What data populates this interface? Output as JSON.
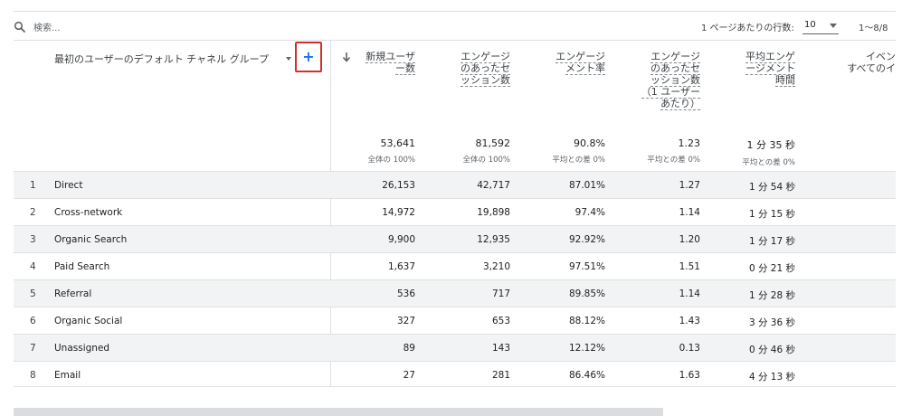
{
  "toolbar": {
    "search_placeholder": "検索...",
    "rows_per_page_label": "1 ページあたりの行数:",
    "rows_per_page_value": "10",
    "pager_text": "1〜8/8"
  },
  "table": {
    "dimension_header": "最初のユーザーのデフォルト チャネル グループ",
    "add_dimension_symbol": "+",
    "columns": [
      {
        "key": "new_users",
        "label_lines": [
          "新規ユーザ",
          "ー数"
        ],
        "total": "53,641",
        "total_sub": "全体の 100%"
      },
      {
        "key": "engaged_sessions",
        "label_lines": [
          "エンゲージ",
          "のあったセ",
          "ッション数"
        ],
        "total": "81,592",
        "total_sub": "全体の 100%"
      },
      {
        "key": "engagement_rate",
        "label_lines": [
          "エンゲージ",
          "メント率"
        ],
        "total": "90.8%",
        "total_sub": "平均との差 0%"
      },
      {
        "key": "engaged_sessions_per_user",
        "label_lines": [
          "エンゲージ",
          "のあったセ",
          "ッション数",
          "（1 ユーザー",
          "あたり）"
        ],
        "total": "1.23",
        "total_sub": "平均との差 0%"
      },
      {
        "key": "avg_engagement_time",
        "label_lines": [
          "平均エンゲ",
          "ージメント",
          "時間"
        ],
        "total": "1 分 35 秒",
        "total_sub": "平均との差 0%"
      },
      {
        "key": "event_count",
        "label_lines": [
          "イベン",
          "すべてのイ"
        ],
        "total": "",
        "total_sub": ""
      }
    ],
    "rows": [
      {
        "index": "1",
        "label": "Direct",
        "new_users": "26,153",
        "engaged_sessions": "42,717",
        "engagement_rate": "87.01%",
        "engaged_sessions_per_user": "1.27",
        "avg_engagement_time": "1 分 54 秒"
      },
      {
        "index": "2",
        "label": "Cross-network",
        "new_users": "14,972",
        "engaged_sessions": "19,898",
        "engagement_rate": "97.4%",
        "engaged_sessions_per_user": "1.14",
        "avg_engagement_time": "1 分 15 秒"
      },
      {
        "index": "3",
        "label": "Organic Search",
        "new_users": "9,900",
        "engaged_sessions": "12,935",
        "engagement_rate": "92.92%",
        "engaged_sessions_per_user": "1.20",
        "avg_engagement_time": "1 分 17 秒"
      },
      {
        "index": "4",
        "label": "Paid Search",
        "new_users": "1,637",
        "engaged_sessions": "3,210",
        "engagement_rate": "97.51%",
        "engaged_sessions_per_user": "1.51",
        "avg_engagement_time": "0 分 21 秒"
      },
      {
        "index": "5",
        "label": "Referral",
        "new_users": "536",
        "engaged_sessions": "717",
        "engagement_rate": "89.85%",
        "engaged_sessions_per_user": "1.14",
        "avg_engagement_time": "1 分 28 秒"
      },
      {
        "index": "6",
        "label": "Organic Social",
        "new_users": "327",
        "engaged_sessions": "653",
        "engagement_rate": "88.12%",
        "engaged_sessions_per_user": "1.43",
        "avg_engagement_time": "3 分 36 秒"
      },
      {
        "index": "7",
        "label": "Unassigned",
        "new_users": "89",
        "engaged_sessions": "143",
        "engagement_rate": "12.12%",
        "engaged_sessions_per_user": "0.13",
        "avg_engagement_time": "0 分 46 秒"
      },
      {
        "index": "8",
        "label": "Email",
        "new_users": "27",
        "engaged_sessions": "281",
        "engagement_rate": "86.46%",
        "engaged_sessions_per_user": "1.63",
        "avg_engagement_time": "4 分 13 秒"
      }
    ]
  },
  "colors": {
    "accent_plus": "#1a73e8",
    "highlight_box": "#d32f2f",
    "row_shade": "#f1f3f4"
  }
}
